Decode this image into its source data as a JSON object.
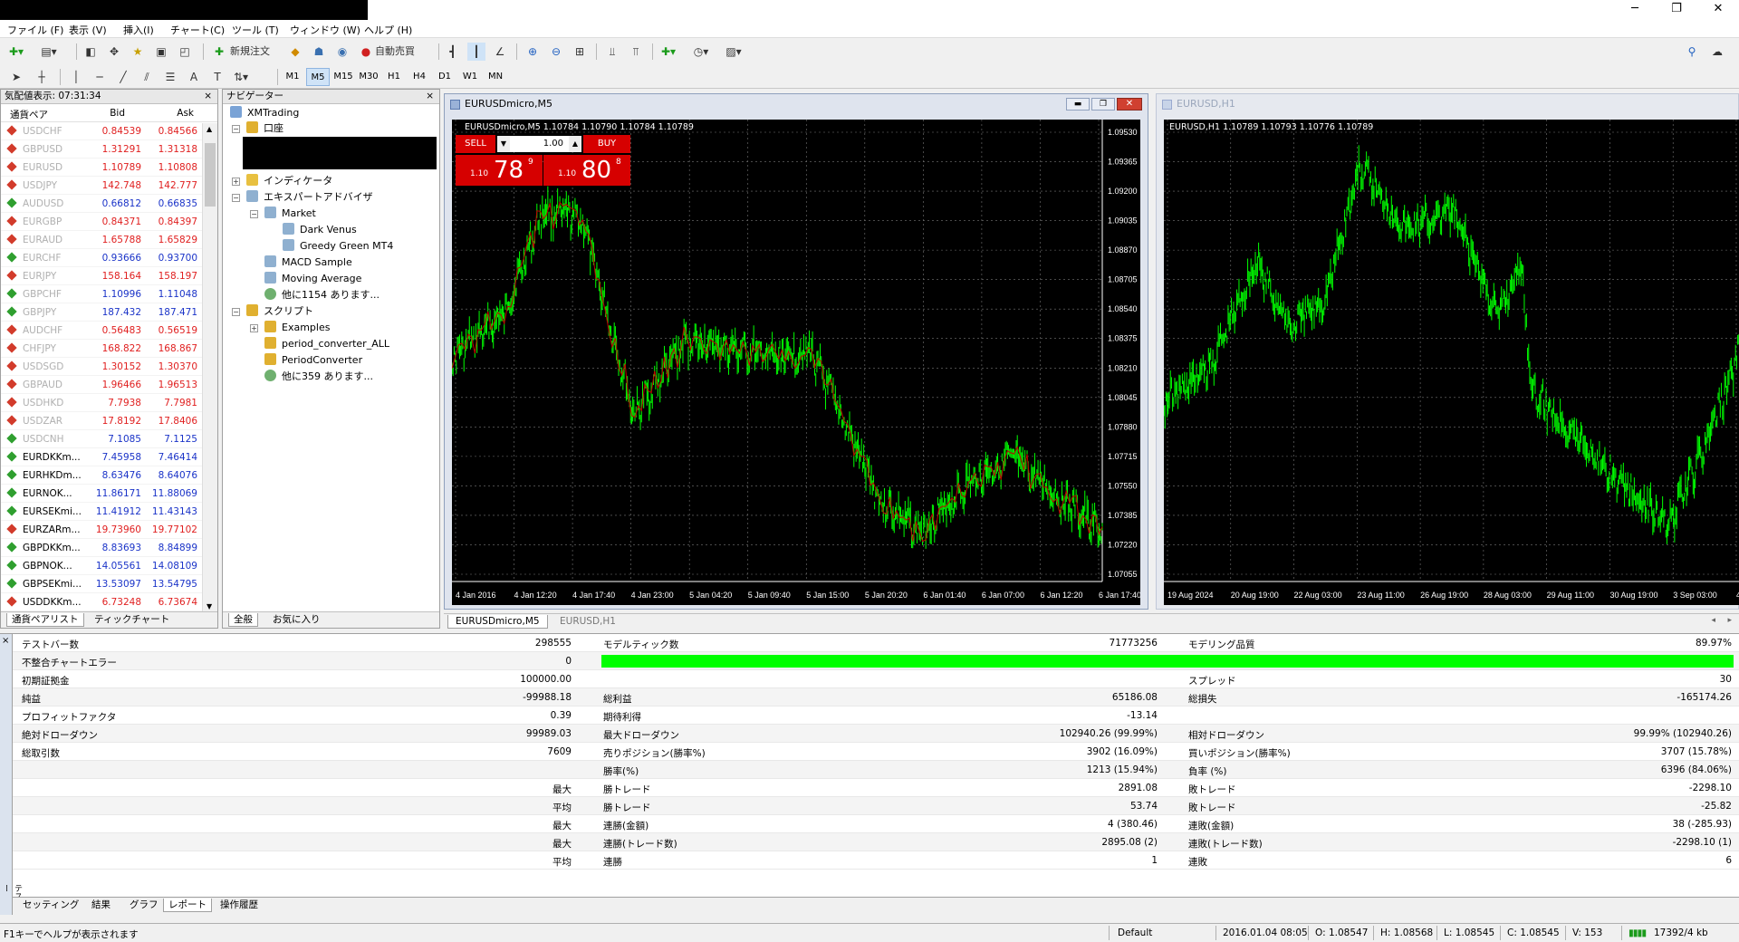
{
  "window": {
    "min": "─",
    "max": "❐",
    "close": "✕"
  },
  "menu": [
    "ファイル (F)",
    "表示 (V)",
    "挿入(I)",
    "チャート(C)",
    "ツール (T)",
    "ウィンドウ (W)",
    "ヘルプ (H)"
  ],
  "toolbar": {
    "new_order": "新規注文",
    "autotrade": "自動売買",
    "timeframes": [
      "M1",
      "M5",
      "M15",
      "M30",
      "H1",
      "H4",
      "D1",
      "W1",
      "MN"
    ]
  },
  "market_watch": {
    "title": "気配値表示: 07:31:34",
    "col_symbol": "通貨ペア",
    "col_bid": "Bid",
    "col_ask": "Ask",
    "rows": [
      {
        "s": "USDCHF",
        "b": "0.84539",
        "a": "0.84566",
        "d": "dn",
        "grey": true
      },
      {
        "s": "GBPUSD",
        "b": "1.31291",
        "a": "1.31318",
        "d": "dn",
        "grey": true
      },
      {
        "s": "EURUSD",
        "b": "1.10789",
        "a": "1.10808",
        "d": "dn",
        "grey": true
      },
      {
        "s": "USDJPY",
        "b": "142.748",
        "a": "142.777",
        "d": "dn",
        "grey": true
      },
      {
        "s": "AUDUSD",
        "b": "0.66812",
        "a": "0.66835",
        "d": "up",
        "grey": true
      },
      {
        "s": "EURGBP",
        "b": "0.84371",
        "a": "0.84397",
        "d": "dn",
        "grey": true
      },
      {
        "s": "EURAUD",
        "b": "1.65788",
        "a": "1.65829",
        "d": "dn",
        "grey": true
      },
      {
        "s": "EURCHF",
        "b": "0.93666",
        "a": "0.93700",
        "d": "up",
        "grey": true
      },
      {
        "s": "EURJPY",
        "b": "158.164",
        "a": "158.197",
        "d": "dn",
        "grey": true
      },
      {
        "s": "GBPCHF",
        "b": "1.10996",
        "a": "1.11048",
        "d": "up",
        "grey": true
      },
      {
        "s": "GBPJPY",
        "b": "187.432",
        "a": "187.471",
        "d": "up",
        "grey": true
      },
      {
        "s": "AUDCHF",
        "b": "0.56483",
        "a": "0.56519",
        "d": "dn",
        "grey": true
      },
      {
        "s": "CHFJPY",
        "b": "168.822",
        "a": "168.867",
        "d": "dn",
        "grey": true
      },
      {
        "s": "USDSGD",
        "b": "1.30152",
        "a": "1.30370",
        "d": "dn",
        "grey": true
      },
      {
        "s": "GBPAUD",
        "b": "1.96466",
        "a": "1.96513",
        "d": "dn",
        "grey": true
      },
      {
        "s": "USDHKD",
        "b": "7.7938",
        "a": "7.7981",
        "d": "dn",
        "grey": true
      },
      {
        "s": "USDZAR",
        "b": "17.8192",
        "a": "17.8406",
        "d": "dn",
        "grey": true
      },
      {
        "s": "USDCNH",
        "b": "7.1085",
        "a": "7.1125",
        "d": "up",
        "grey": true
      },
      {
        "s": "EURDKKm...",
        "b": "7.45958",
        "a": "7.46414",
        "d": "up",
        "grey": false
      },
      {
        "s": "EURHKDm...",
        "b": "8.63476",
        "a": "8.64076",
        "d": "up",
        "grey": false
      },
      {
        "s": "EURNOK...",
        "b": "11.86171",
        "a": "11.88069",
        "d": "up",
        "grey": false
      },
      {
        "s": "EURSEKmi...",
        "b": "11.41912",
        "a": "11.43143",
        "d": "up",
        "grey": false
      },
      {
        "s": "EURZARm...",
        "b": "19.73960",
        "a": "19.77102",
        "d": "dn",
        "grey": false
      },
      {
        "s": "GBPDKKm...",
        "b": "8.83693",
        "a": "8.84899",
        "d": "up",
        "grey": false
      },
      {
        "s": "GBPNOK...",
        "b": "14.05561",
        "a": "14.08109",
        "d": "up",
        "grey": false
      },
      {
        "s": "GBPSEKmi...",
        "b": "13.53097",
        "a": "13.54795",
        "d": "up",
        "grey": false
      },
      {
        "s": "USDDKKm...",
        "b": "6.73248",
        "a": "6.73674",
        "d": "dn",
        "grey": false
      }
    ],
    "tabs": [
      "通貨ペアリスト",
      "ティックチャート"
    ]
  },
  "navigator": {
    "title": "ナビゲーター",
    "root": "XMTrading",
    "accounts": "口座",
    "indicators": "インディケータ",
    "experts": "エキスパートアドバイザ",
    "market": "Market",
    "ea1": "Dark Venus",
    "ea2": "Greedy Green MT4",
    "macd": "MACD Sample",
    "ma": "Moving Average",
    "more1": "他に1154 あります...",
    "scripts": "スクリプト",
    "examples": "Examples",
    "sc1": "period_converter_ALL",
    "sc2": "PeriodConverter",
    "more2": "他に359 あります...",
    "tabs": [
      "全般",
      "お気に入り"
    ]
  },
  "chart1": {
    "title": "EURUSDmicro,M5",
    "info": "EURUSDmicro,M5  1.10784 1.10790 1.10784 1.10789",
    "sell": "SELL",
    "buy": "BUY",
    "lot": "1.00",
    "sell_pre": "1.10",
    "sell_big": "78",
    "sell_sup": "9",
    "buy_pre": "1.10",
    "buy_big": "80",
    "buy_sup": "8",
    "y_ticks": [
      "1.09530",
      "1.09365",
      "1.09200",
      "1.09035",
      "1.08870",
      "1.08705",
      "1.08540",
      "1.08375",
      "1.08210",
      "1.08045",
      "1.07880",
      "1.07715",
      "1.07550",
      "1.07385",
      "1.07220",
      "1.07055"
    ],
    "x_ticks": [
      "4 Jan 2016",
      "4 Jan 12:20",
      "4 Jan 17:40",
      "4 Jan 23:00",
      "5 Jan 04:20",
      "5 Jan 09:40",
      "5 Jan 15:00",
      "5 Jan 20:20",
      "6 Jan 01:40",
      "6 Jan 07:00",
      "6 Jan 12:20",
      "6 Jan 17:40"
    ]
  },
  "chart2": {
    "title": "EURUSD,H1",
    "info": "EURUSD,H1  1.10789 1.10793 1.10776 1.10789",
    "x_ticks": [
      "19 Aug 2024",
      "20 Aug 19:00",
      "22 Aug 03:00",
      "23 Aug 11:00",
      "26 Aug 19:00",
      "28 Aug 03:00",
      "29 Aug 11:00",
      "30 Aug 19:00",
      "3 Sep 03:00",
      "4 Sep 11:00"
    ]
  },
  "chart_tabs": [
    "EURUSDmicro,M5",
    "EURUSD,H1"
  ],
  "report": {
    "bars_l": "テストバー数",
    "bars_v": "298555",
    "ticks_l": "モデルティック数",
    "ticks_v": "71773256",
    "quality_l": "モデリング品質",
    "quality_v": "89.97%",
    "mismatch_l": "不整合チャートエラー",
    "mismatch_v": "0",
    "deposit_l": "初期証拠金",
    "deposit_v": "100000.00",
    "spread_l": "スプレッド",
    "spread_v": "30",
    "profit_l": "純益",
    "profit_v": "-99988.18",
    "gp_l": "総利益",
    "gp_v": "65186.08",
    "gl_l": "総損失",
    "gl_v": "-165174.26",
    "pf_l": "プロフィットファクタ",
    "pf_v": "0.39",
    "ep_l": "期待利得",
    "ep_v": "-13.14",
    "add_l": "絶対ドローダウン",
    "add_v": "99989.03",
    "mdd_l": "最大ドローダウン",
    "mdd_v": "102940.26 (99.99%)",
    "rdd_l": "相対ドローダウン",
    "rdd_v": "99.99% (102940.26)",
    "trades_l": "総取引数",
    "trades_v": "7609",
    "short_l": "売りポジション(勝率%)",
    "short_v": "3902 (16.09%)",
    "long_l": "買いポジション(勝率%)",
    "long_v": "3707 (15.78%)",
    "winp_l": "勝率(%)",
    "winp_v": "1213 (15.94%)",
    "lossp_l": "負率 (%)",
    "lossp_v": "6396 (84.06%)",
    "max": "最大",
    "avg": "平均",
    "lw_l": "勝トレード",
    "lw_v": "2891.08",
    "ll_l": "敗トレード",
    "ll_v": "-2298.10",
    "aw_l": "勝トレード",
    "aw_v": "53.74",
    "al_l": "敗トレード",
    "al_v": "-25.82",
    "cw_l": "連勝(金額)",
    "cw_v": "4 (380.46)",
    "cl_l": "連敗(金額)",
    "cl_v": "38 (-285.93)",
    "cw2_l": "連勝(トレード数)",
    "cw2_v": "2895.08 (2)",
    "cl2_l": "連敗(トレード数)",
    "cl2_v": "-2298.10 (1)",
    "acw_l": "連勝",
    "acw_v": "1",
    "acl_l": "連敗",
    "acl_v": "6",
    "side": "テスター",
    "tabs": [
      "セッティング",
      "結果",
      "グラフ",
      "レポート",
      "操作履歴"
    ]
  },
  "status": {
    "help": "F1キーでヘルプが表示されます",
    "profile": "Default",
    "time": "2016.01.04 08:05",
    "o": "O: 1.08547",
    "h": "H: 1.08568",
    "l": "L: 1.08545",
    "c": "C: 1.08545",
    "v": "V: 153",
    "conn": "17392/4 kb"
  },
  "colors": {
    "bull": "#00ff00",
    "grey": "#b0b0b0",
    "up_num": "#1a33c8",
    "dn_num": "#e02020",
    "sell_bg": "#d60000"
  }
}
